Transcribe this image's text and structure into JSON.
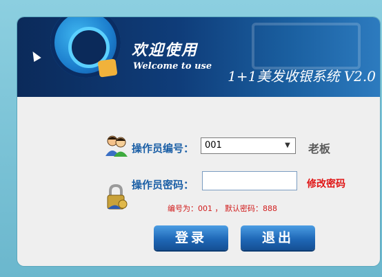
{
  "banner": {
    "welcome_cn": "欢迎使用",
    "welcome_en": "Welcome to use",
    "app_title": "1+1美发收银系统 V2.0"
  },
  "form": {
    "operator_id_label": "操作员编号：",
    "operator_id_value": "001",
    "operator_role": "老板",
    "password_label": "操作员密码：",
    "password_value": "",
    "change_password_link": "修改密码",
    "hint": "编号为：001 ， 默认密码：888"
  },
  "buttons": {
    "login_label": "登录",
    "exit_label": "退出"
  },
  "icons": {
    "person": "users-icon",
    "lock": "lock-icon",
    "dropdown": "chevron-down-icon"
  },
  "colors": {
    "banner_dark": "#0b2a5a",
    "banner_light": "#2d7bbf",
    "label_blue": "#1b5fa6",
    "warning_red": "#e01414",
    "button_blue": "#1f68b7"
  }
}
